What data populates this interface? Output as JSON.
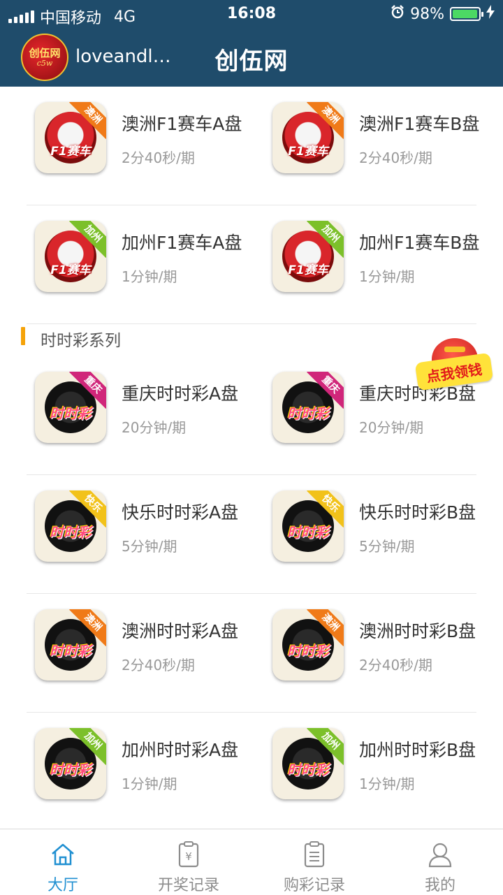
{
  "status": {
    "carrier": "中国移动",
    "network": "4G",
    "time": "16:08",
    "battery": "98%",
    "battery_level": 0.98
  },
  "header": {
    "username": "loveandlo...",
    "title": "创伍网",
    "logo_text_1": "创伍网",
    "logo_text_2": "c5w"
  },
  "rows": [
    {
      "items": [
        {
          "name": "澳洲F1赛车A盘",
          "period": "2分40秒/期",
          "tag": "澳洲",
          "tag_color": "#f07a18",
          "icon": "f1-racing-icon",
          "icon_text": "F1赛车"
        },
        {
          "name": "澳洲F1赛车B盘",
          "period": "2分40秒/期",
          "tag": "澳洲",
          "tag_color": "#f07a18",
          "icon": "f1-racing-icon",
          "icon_text": "F1赛车"
        }
      ]
    },
    {
      "items": [
        {
          "name": "加州F1赛车A盘",
          "period": "1分钟/期",
          "tag": "加州",
          "tag_color": "#7cc02a",
          "icon": "f1-racing-icon",
          "icon_text": "F1赛车"
        },
        {
          "name": "加州F1赛车B盘",
          "period": "1分钟/期",
          "tag": "加州",
          "tag_color": "#7cc02a",
          "icon": "f1-racing-icon",
          "icon_text": "F1赛车"
        }
      ]
    }
  ],
  "section": {
    "label": "时时彩系列"
  },
  "ssc_rows": [
    {
      "items": [
        {
          "name": "重庆时时彩A盘",
          "period": "20分钟/期",
          "tag": "重庆",
          "tag_color": "#d0267a",
          "icon": "ssc-lottery-icon",
          "icon_text": "时时彩"
        },
        {
          "name": "重庆时时彩B盘",
          "period": "20分钟/期",
          "tag": "重庆",
          "tag_color": "#d0267a",
          "icon": "ssc-lottery-icon",
          "icon_text": "时时彩"
        }
      ]
    },
    {
      "items": [
        {
          "name": "快乐时时彩A盘",
          "period": "5分钟/期",
          "tag": "快乐",
          "tag_color": "#f2c21a",
          "icon": "ssc-lottery-icon",
          "icon_text": "时时彩"
        },
        {
          "name": "快乐时时彩B盘",
          "period": "5分钟/期",
          "tag": "快乐",
          "tag_color": "#f2c21a",
          "icon": "ssc-lottery-icon",
          "icon_text": "时时彩"
        }
      ]
    },
    {
      "items": [
        {
          "name": "澳洲时时彩A盘",
          "period": "2分40秒/期",
          "tag": "澳洲",
          "tag_color": "#f07a18",
          "icon": "ssc-lottery-icon",
          "icon_text": "时时彩"
        },
        {
          "name": "澳洲时时彩B盘",
          "period": "2分40秒/期",
          "tag": "澳洲",
          "tag_color": "#f07a18",
          "icon": "ssc-lottery-icon",
          "icon_text": "时时彩"
        }
      ]
    },
    {
      "items": [
        {
          "name": "加州时时彩A盘",
          "period": "1分钟/期",
          "tag": "加州",
          "tag_color": "#7cc02a",
          "icon": "ssc-lottery-icon",
          "icon_text": "时时彩"
        },
        {
          "name": "加州时时彩B盘",
          "period": "1分钟/期",
          "tag": "加州",
          "tag_color": "#7cc02a",
          "icon": "ssc-lottery-icon",
          "icon_text": "时时彩"
        }
      ]
    }
  ],
  "promo": {
    "label": "点我领钱"
  },
  "tabs": [
    {
      "label": "大厅",
      "icon": "home-icon",
      "active": true
    },
    {
      "label": "开奖记录",
      "icon": "clipboard-yen-icon",
      "active": false
    },
    {
      "label": "购彩记录",
      "icon": "document-list-icon",
      "active": false
    },
    {
      "label": "我的",
      "icon": "user-icon",
      "active": false
    }
  ],
  "colors": {
    "header_bg": "#1f4c6b",
    "accent": "#1f8fd1",
    "section_bar": "#f5a30a"
  }
}
